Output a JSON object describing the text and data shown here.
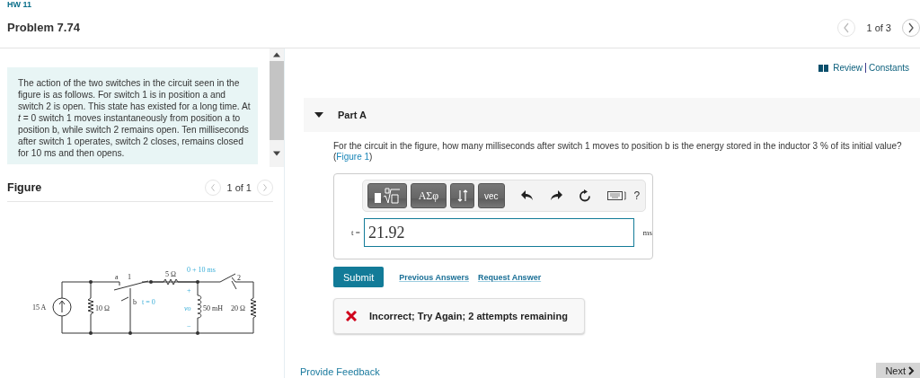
{
  "breadcrumb": "HW 11",
  "header": {
    "title": "Problem 7.74",
    "pager": "1 of 3"
  },
  "problem_text": "The action of the two switches in the circuit seen in the figure is as follows. For switch 1 is in position a and switch 2 is open. This state has existed for a long time. At *t* = 0 switch 1 moves instantaneously from position a to position b, while switch 2 remains open. Ten milliseconds after switch 1 operates, switch 2 closes, remains closed for 10 ms and then opens.",
  "figure": {
    "heading": "Figure",
    "pager": "1 of 1",
    "labels": {
      "source": "15 A",
      "r1": "10 Ω",
      "pos_a": "a",
      "sw1": "1",
      "pos_b": "b",
      "t0": "t = 0",
      "r2": "5 Ω",
      "sw2_time": "0 + 10 ms",
      "sw2": "2",
      "plus": "+",
      "vo": "vo",
      "inductor": "50 mH",
      "r3": "20 Ω",
      "minus": "−"
    }
  },
  "links": {
    "review": "Review",
    "constants": "Constants"
  },
  "part": {
    "title": "Part A",
    "expanded": true,
    "question": "For the circuit in the figure, how many milliseconds after switch 1 moves to position b is the energy stored in the inductor 3 % of its initial value?(",
    "figure_link": "Figure 1",
    "question_end": ")"
  },
  "toolbar": {
    "symbols": "ΑΣφ",
    "vector": "vec",
    "help": "?"
  },
  "answer": {
    "variable": "t =",
    "value": "21.92",
    "unit": "ms"
  },
  "buttons": {
    "submit": "Submit",
    "previous": "Previous Answers",
    "request": "Request Answer"
  },
  "feedback": {
    "kind": "incorrect",
    "message": "Incorrect; Try Again; 2 attempts remaining"
  },
  "footer": {
    "feedback_link": "Provide Feedback",
    "next": "Next"
  }
}
